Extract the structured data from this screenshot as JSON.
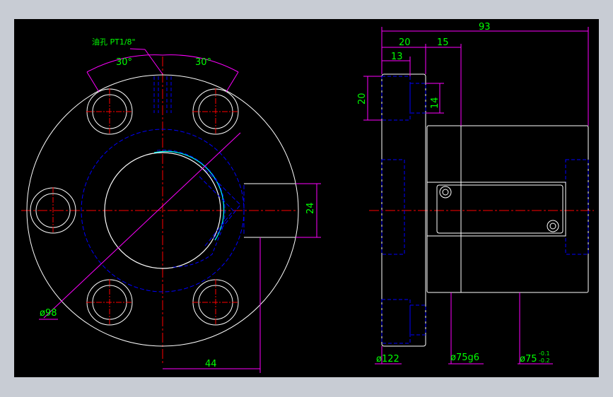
{
  "drawing": {
    "front_view": {
      "oil_hole_label": "油孔 PT1/8\"",
      "angle_left": "30°",
      "angle_right": "30°",
      "bolt_circle_label": "ø98",
      "offset_dim": "44",
      "key_dim": "24"
    },
    "side_view": {
      "overall_length": "93",
      "flange_thickness": "20",
      "step_dim": "15",
      "hole_depth": "13",
      "counterbore_dia": "20",
      "hole_dia": "14",
      "flange_dia": "ø122",
      "body_dia": "ø75g6",
      "bore_dia": "ø75",
      "bore_tol_upper": "-0.1",
      "bore_tol_lower": "-0.2"
    }
  },
  "colors": {
    "background": "#000000",
    "frame": "#c8ccd4",
    "outline": "#ffffff",
    "hidden": "#0000ff",
    "center": "#ff0000",
    "dimension": "#ff00ff",
    "text": "#00ff00",
    "thread": "#00ffff"
  }
}
